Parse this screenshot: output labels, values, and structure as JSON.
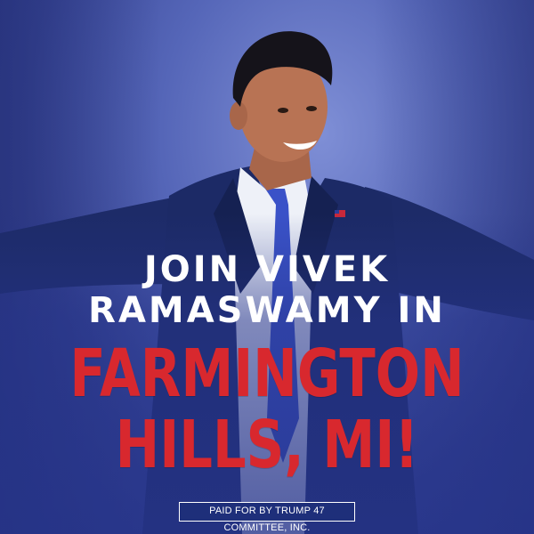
{
  "headline": {
    "line1": "JOIN VIVEK",
    "line2": "RAMASWAMY IN"
  },
  "location": {
    "line1": "FARMINGTON",
    "line2": "HILLS, MI!"
  },
  "disclaimer": "PAID FOR BY TRUMP 47 COMMITTEE, INC.",
  "colors": {
    "background": "#3b4a9e",
    "headline": "#ffffff",
    "location": "#d8282e",
    "disclaimer_box": "#1e2f7a",
    "suit": "#1c2a66",
    "tie": "#3a52c8"
  }
}
